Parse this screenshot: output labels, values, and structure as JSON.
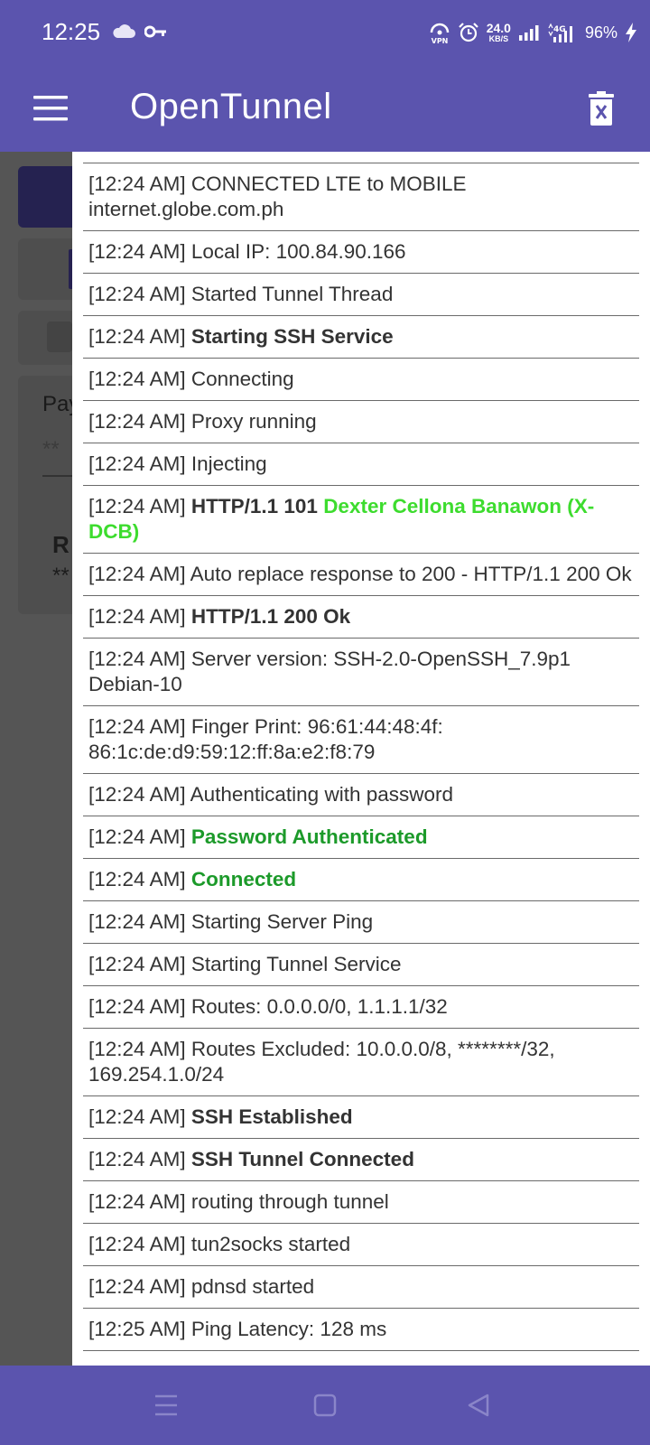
{
  "status_bar": {
    "time": "12:25",
    "net_speed_value": "24.0",
    "net_speed_unit": "KB/S",
    "battery": "96%",
    "icons": [
      "cloud-icon",
      "key-icon",
      "vpn-icon",
      "alarm-icon",
      "signal-icon",
      "signal-4g-icon",
      "charging-icon"
    ],
    "vpn_label": "VPN",
    "network_type": "4G"
  },
  "app_bar": {
    "title": "OpenTunnel",
    "menu_icon": "hamburger-menu-icon",
    "trash_icon": "trash-icon"
  },
  "background_partial": {
    "label_1": "Pay",
    "value_1": "**",
    "label_2": "R",
    "value_2": "**"
  },
  "log": {
    "entries": [
      {
        "time": "[12:24 AM]",
        "parts": [
          {
            "t": "CONNECTED LTE to MOBILE internet.globe.com.ph",
            "s": "n"
          }
        ]
      },
      {
        "time": "[12:24 AM]",
        "parts": [
          {
            "t": "Local IP: 100.84.90.166",
            "s": "n"
          }
        ]
      },
      {
        "time": "[12:24 AM]",
        "parts": [
          {
            "t": "Started Tunnel Thread",
            "s": "n"
          }
        ]
      },
      {
        "time": "[12:24 AM]",
        "parts": [
          {
            "t": "Starting SSH Service",
            "s": "b"
          }
        ]
      },
      {
        "time": "[12:24 AM]",
        "parts": [
          {
            "t": "Connecting",
            "s": "n"
          }
        ]
      },
      {
        "time": "[12:24 AM]",
        "parts": [
          {
            "t": "Proxy running",
            "s": "n"
          }
        ]
      },
      {
        "time": "[12:24 AM]",
        "parts": [
          {
            "t": "Injecting",
            "s": "n"
          }
        ]
      },
      {
        "time": "[12:24 AM]",
        "parts": [
          {
            "t": "HTTP/1.1 101",
            "s": "b"
          },
          {
            "t": "Dexter Cellona Banawon (X-DCB)",
            "s": "lg"
          }
        ]
      },
      {
        "time": "[12:24 AM]",
        "parts": [
          {
            "t": "Auto replace response to 200 - HTTP/1.1 200 Ok",
            "s": "n"
          }
        ]
      },
      {
        "time": "[12:24 AM]",
        "parts": [
          {
            "t": "HTTP/1.1 200 Ok",
            "s": "b"
          }
        ]
      },
      {
        "time": "[12:24 AM]",
        "parts": [
          {
            "t": "Server version: SSH-2.0-OpenSSH_7.9p1 Debian-10",
            "s": "n"
          }
        ]
      },
      {
        "time": "[12:24 AM]",
        "parts": [
          {
            "t": "Finger Print: 96:61:44:48:4f: 86:1c:de:d9:59:12:ff:8a:e2:f8:79",
            "s": "n"
          }
        ]
      },
      {
        "time": "[12:24 AM]",
        "parts": [
          {
            "t": "Authenticating with password",
            "s": "n"
          }
        ]
      },
      {
        "time": "[12:24 AM]",
        "parts": [
          {
            "t": "Password Authenticated",
            "s": "g"
          }
        ]
      },
      {
        "time": "[12:24 AM]",
        "parts": [
          {
            "t": "Connected",
            "s": "g"
          }
        ]
      },
      {
        "time": "[12:24 AM]",
        "parts": [
          {
            "t": "Starting Server Ping",
            "s": "n"
          }
        ]
      },
      {
        "time": "[12:24 AM]",
        "parts": [
          {
            "t": "Starting Tunnel Service",
            "s": "n"
          }
        ]
      },
      {
        "time": "[12:24 AM]",
        "parts": [
          {
            "t": "Routes: 0.0.0.0/0, 1.1.1.1/32",
            "s": "n"
          }
        ]
      },
      {
        "time": "[12:24 AM]",
        "parts": [
          {
            "t": "Routes Excluded: 10.0.0.0/8, ********/32, 169.254.1.0/24",
            "s": "n"
          }
        ]
      },
      {
        "time": "[12:24 AM]",
        "parts": [
          {
            "t": "SSH Established",
            "s": "b"
          }
        ]
      },
      {
        "time": "[12:24 AM]",
        "parts": [
          {
            "t": "SSH Tunnel Connected",
            "s": "b"
          }
        ]
      },
      {
        "time": "[12:24 AM]",
        "parts": [
          {
            "t": "routing through tunnel",
            "s": "n"
          }
        ]
      },
      {
        "time": "[12:24 AM]",
        "parts": [
          {
            "t": "tun2socks started",
            "s": "n"
          }
        ]
      },
      {
        "time": "[12:24 AM]",
        "parts": [
          {
            "t": "pdnsd started",
            "s": "n"
          }
        ]
      },
      {
        "time": "[12:25 AM]",
        "parts": [
          {
            "t": "Ping Latency: 128 ms",
            "s": "n"
          }
        ]
      }
    ]
  },
  "nav_bar": {
    "icons": [
      "recent-apps-icon",
      "home-icon",
      "back-icon"
    ]
  },
  "colors": {
    "primary": "#5b54ae",
    "success_green": "#1c9a2a",
    "highlight_green": "#3ddc2e",
    "log_text": "#333333",
    "divider": "#6a6a6a"
  }
}
